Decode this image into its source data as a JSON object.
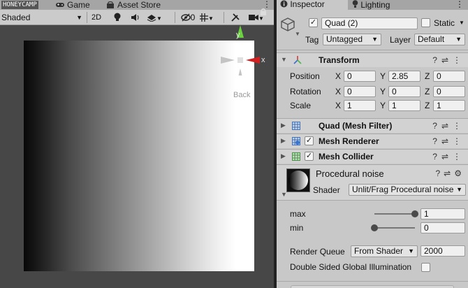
{
  "watermark": "HONEYCAMP",
  "scene_tabs": [
    {
      "label": "Game",
      "icon": "gamepad-icon"
    },
    {
      "label": "Asset Store",
      "icon": "store-icon"
    }
  ],
  "scene_toolbar": {
    "shading_mode": "Shaded",
    "mode_2d": "2D",
    "hidden_count": "0"
  },
  "gizmo": {
    "y": "y",
    "x": "x",
    "view_label": "Back"
  },
  "inspector": {
    "tabs": [
      {
        "label": "Inspector",
        "icon": "info-icon"
      },
      {
        "label": "Lighting",
        "icon": "bulb-icon"
      }
    ],
    "object": {
      "name": "Quad (2)",
      "active": true,
      "static_label": "Static",
      "tag_label": "Tag",
      "tag_value": "Untagged",
      "layer_label": "Layer",
      "layer_value": "Default"
    },
    "transform": {
      "title": "Transform",
      "rows": [
        {
          "label": "Position",
          "x": "0",
          "y": "2.85",
          "z": "0"
        },
        {
          "label": "Rotation",
          "x": "0",
          "y": "0",
          "z": "0"
        },
        {
          "label": "Scale",
          "x": "1",
          "y": "1",
          "z": "1"
        }
      ],
      "axis_x": "X",
      "axis_y": "Y",
      "axis_z": "Z"
    },
    "components": [
      {
        "title": "Quad (Mesh Filter)"
      },
      {
        "title": "Mesh Renderer",
        "enabled": true
      },
      {
        "title": "Mesh Collider",
        "enabled": true
      }
    ],
    "material": {
      "name": "Procedural noise",
      "shader_label": "Shader",
      "shader_value": "Unlit/Frag Procedural noise",
      "props": [
        {
          "label": "max",
          "value": "1",
          "slider_fraction": 1.0
        },
        {
          "label": "min",
          "value": "0",
          "slider_fraction": 0.0
        }
      ],
      "render_queue_label": "Render Queue",
      "render_queue_mode": "From Shader",
      "render_queue_value": "2000",
      "dsgi_label": "Double Sided Global Illumination"
    }
  },
  "colors": {
    "axis_x": "#d21f1f",
    "axis_y": "#5ed13a",
    "transform_icon": "#d23c3c"
  }
}
